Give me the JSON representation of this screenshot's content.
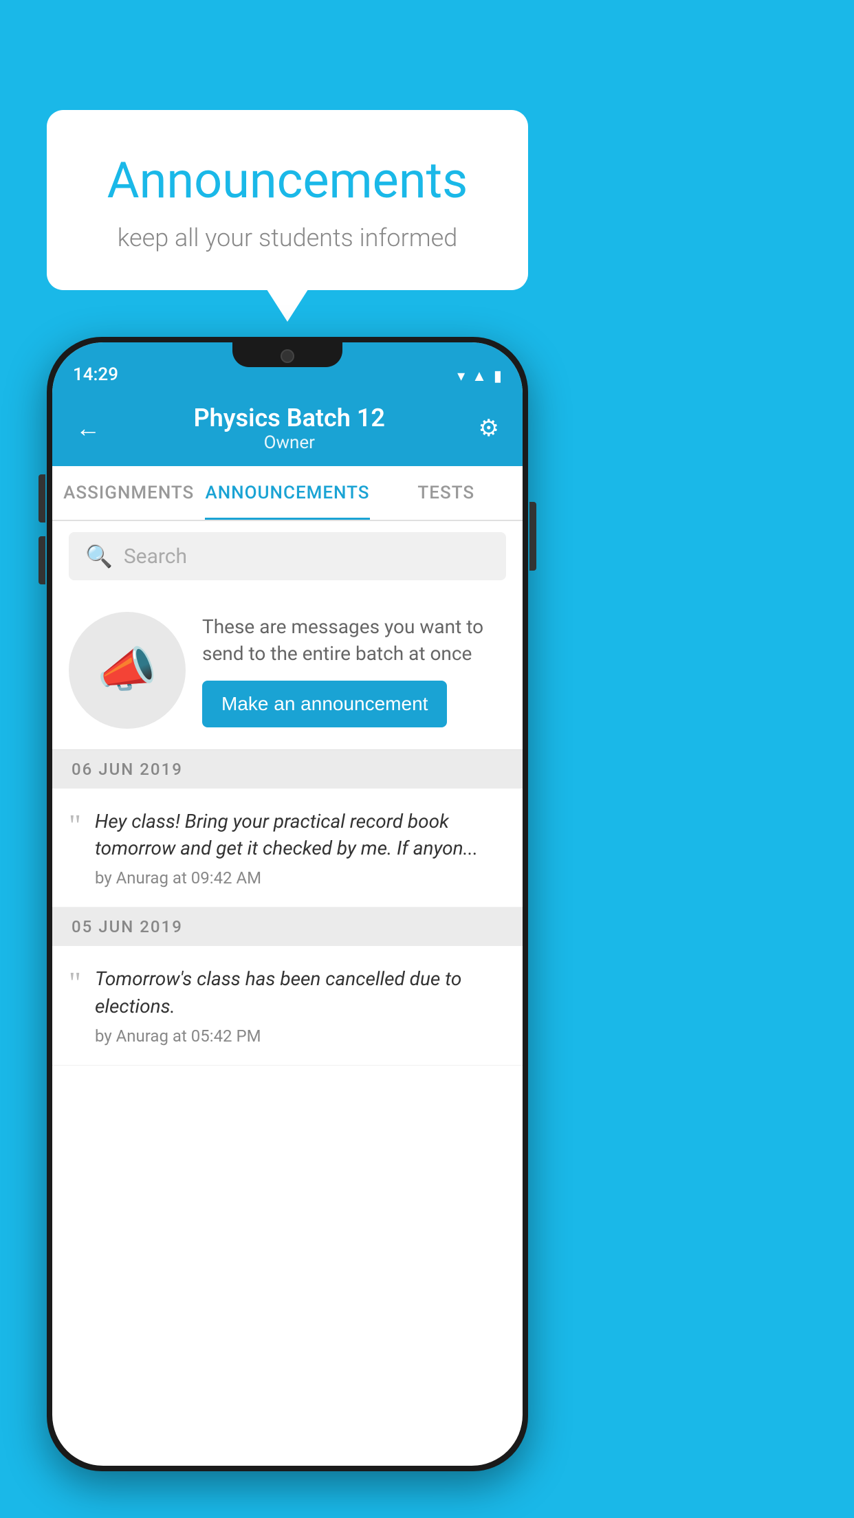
{
  "background_color": "#1ab8e8",
  "speech_bubble": {
    "title": "Announcements",
    "subtitle": "keep all your students informed"
  },
  "phone": {
    "status_bar": {
      "time": "14:29"
    },
    "app_bar": {
      "back_label": "←",
      "batch_name": "Physics Batch 12",
      "batch_role": "Owner",
      "gear_label": "⚙"
    },
    "tabs": [
      {
        "label": "ASSIGNMENTS",
        "active": false
      },
      {
        "label": "ANNOUNCEMENTS",
        "active": true
      },
      {
        "label": "TESTS",
        "active": false
      },
      {
        "label": "...",
        "active": false
      }
    ],
    "search": {
      "placeholder": "Search"
    },
    "promo": {
      "text": "These are messages you want to send to the entire batch at once",
      "button_label": "Make an announcement"
    },
    "announcements": [
      {
        "date": "06  JUN  2019",
        "text": "Hey class! Bring your practical record book tomorrow and get it checked by me. If anyon...",
        "meta": "by Anurag at 09:42 AM"
      },
      {
        "date": "05  JUN  2019",
        "text": "Tomorrow's class has been cancelled due to elections.",
        "meta": "by Anurag at 05:42 PM"
      }
    ]
  }
}
